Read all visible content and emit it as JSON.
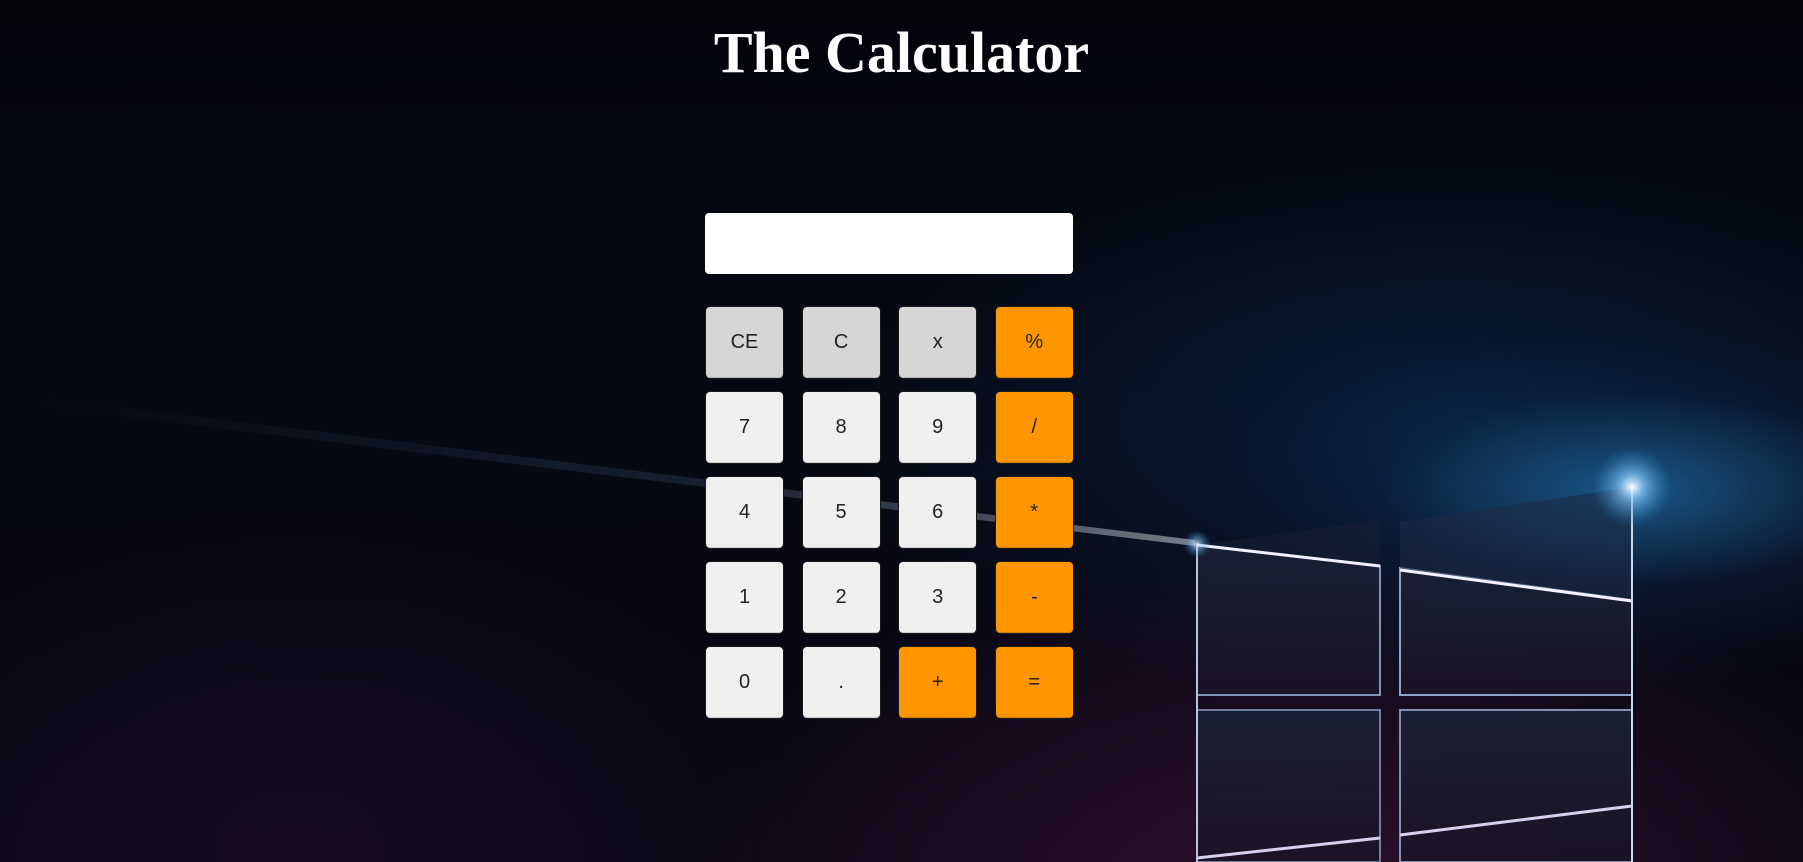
{
  "page": {
    "title": "The Calculator"
  },
  "calculator": {
    "display_value": "",
    "keys": [
      {
        "label": "CE",
        "kind": "func"
      },
      {
        "label": "C",
        "kind": "func"
      },
      {
        "label": "x",
        "kind": "func"
      },
      {
        "label": "%",
        "kind": "op"
      },
      {
        "label": "7",
        "kind": "num"
      },
      {
        "label": "8",
        "kind": "num"
      },
      {
        "label": "9",
        "kind": "num"
      },
      {
        "label": "/",
        "kind": "op"
      },
      {
        "label": "4",
        "kind": "num"
      },
      {
        "label": "5",
        "kind": "num"
      },
      {
        "label": "6",
        "kind": "num"
      },
      {
        "label": "*",
        "kind": "op"
      },
      {
        "label": "1",
        "kind": "num"
      },
      {
        "label": "2",
        "kind": "num"
      },
      {
        "label": "3",
        "kind": "num"
      },
      {
        "label": "-",
        "kind": "op"
      },
      {
        "label": "0",
        "kind": "num"
      },
      {
        "label": ".",
        "kind": "num"
      },
      {
        "label": "+",
        "kind": "op"
      },
      {
        "label": "=",
        "kind": "op"
      }
    ]
  },
  "colors": {
    "operator_key": "#ff9600",
    "function_key": "#d6d6d6",
    "number_key": "#f0f0f0",
    "title_text": "#ffffff"
  }
}
